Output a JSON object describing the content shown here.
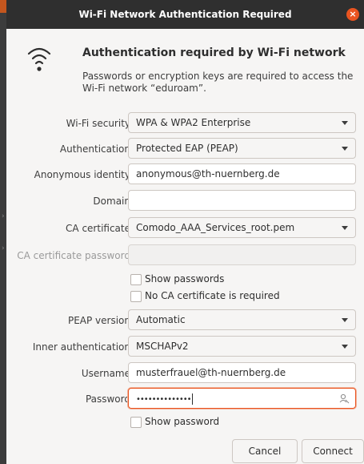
{
  "dialog": {
    "title": "Wi-Fi Network Authentication Required",
    "close_symbol": "×",
    "heading": "Authentication required by Wi-Fi network",
    "description": "Passwords or encryption keys are required to access the Wi-Fi network “eduroam”."
  },
  "form": {
    "wifi_security": {
      "label": "Wi-Fi security",
      "value": "WPA & WPA2 Enterprise"
    },
    "authentication": {
      "label": "Authentication",
      "value": "Protected EAP (PEAP)"
    },
    "anonymous_identity": {
      "label": "Anonymous identity",
      "value": "anonymous@th-nuernberg.de"
    },
    "domain": {
      "label": "Domain",
      "value": ""
    },
    "ca_certificate": {
      "label": "CA certificate",
      "value": "Comodo_AAA_Services_root.pem"
    },
    "ca_certificate_password": {
      "label": "CA certificate password",
      "value": ""
    },
    "show_passwords": {
      "label": "Show passwords",
      "checked": false
    },
    "no_ca_required": {
      "label": "No CA certificate is required",
      "checked": false
    },
    "peap_version": {
      "label": "PEAP version",
      "value": "Automatic"
    },
    "inner_authentication": {
      "label": "Inner authentication",
      "value": "MSCHAPv2"
    },
    "username": {
      "label": "Username",
      "value": "musterfrauel@th-nuernberg.de"
    },
    "password": {
      "label": "Password",
      "value": "••••••••••••••"
    },
    "show_password": {
      "label": "Show password",
      "checked": false
    }
  },
  "buttons": {
    "cancel": "Cancel",
    "connect": "Connect"
  },
  "colors": {
    "titlebar": "#2f2f2f",
    "accent": "#e95420",
    "dialog_bg": "#f6f5f4"
  },
  "icons": [
    "wifi-icon",
    "close-icon",
    "chevron-down-icon",
    "reveal-password-icon"
  ]
}
